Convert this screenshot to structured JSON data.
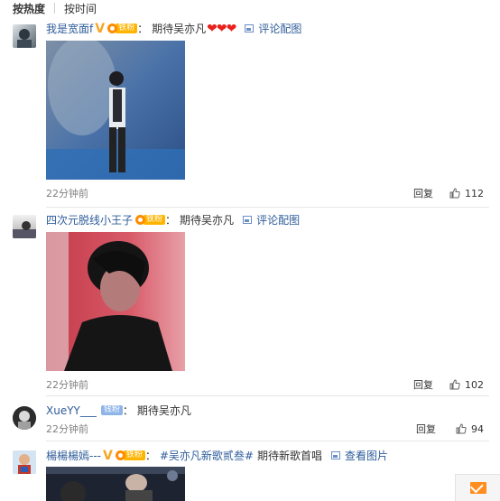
{
  "sort": {
    "hot": "按热度",
    "time": "按时间"
  },
  "comments": [
    {
      "user": "我是宽面f",
      "v": "V",
      "fan_label": "铁粉",
      "colon": "：",
      "text": "期待吴亦凡",
      "hearts": "❤❤❤",
      "pic_link": "评论配图",
      "time": "22分钟前",
      "reply": "回复",
      "likes": "112"
    },
    {
      "user": "四次元脱线小王子",
      "fan_label": "铁粉",
      "colon": "：",
      "text": "期待吴亦凡",
      "pic_link": "评论配图",
      "time": "22分钟前",
      "reply": "回复",
      "likes": "102"
    },
    {
      "user": "XueYY___",
      "fan_label": "钱粉",
      "colon": "：",
      "text": "期待吴亦凡",
      "time": "22分钟前",
      "reply": "回复",
      "likes": "94"
    },
    {
      "user": "楊楊楊嫣---",
      "v": "V",
      "fan_label": "铁粉",
      "colon": "：",
      "topic": "#吴亦凡新歌贰叁#",
      "text": "期待新歌首唱",
      "pic_link": "查看图片"
    }
  ],
  "colors": {
    "link": "#2e5c9a",
    "fan_badge": "#ffb400",
    "heart": "#e8231e",
    "mail": "#ff8d1f"
  }
}
